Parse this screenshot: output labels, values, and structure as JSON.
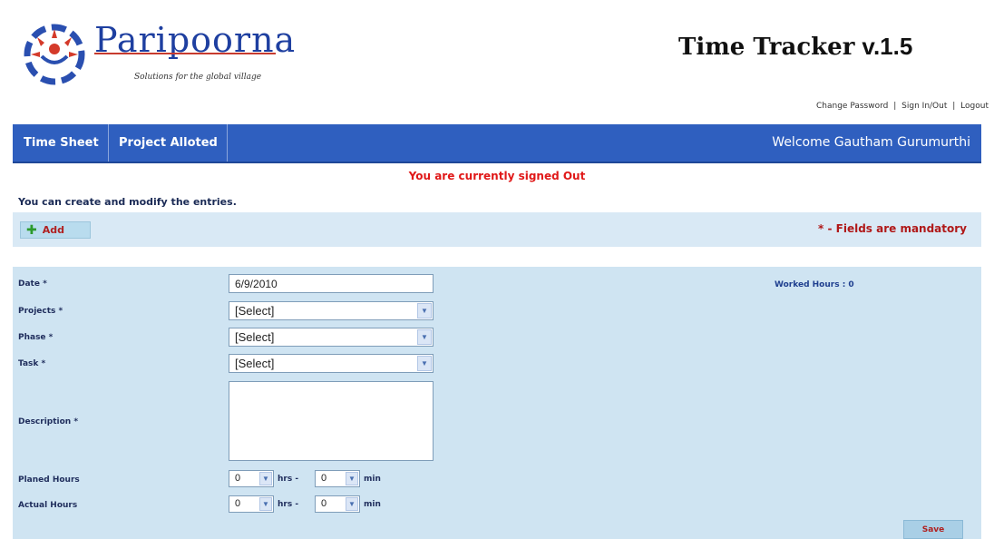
{
  "brand": {
    "name": "Paripoorna",
    "tagline": "Solutions for the global village"
  },
  "app": {
    "title": "Time Tracker",
    "version": "v.1.5"
  },
  "user_links": {
    "change_password": "Change Password",
    "sign_in_out": "Sign In/Out",
    "logout": "Logout",
    "separator": "|"
  },
  "nav": {
    "time_sheet": "Time Sheet",
    "project_alloted": "Project Alloted",
    "welcome": "Welcome Gautham Gurumurthi"
  },
  "status_message": "You are currently signed Out",
  "info_message": "You can create and modify the entries.",
  "toolbar": {
    "add_label": "Add",
    "mandatory_note": "* - Fields are mandatory"
  },
  "form": {
    "date_label": "Date *",
    "date_value": "6/9/2010",
    "projects_label": "Projects *",
    "projects_value": "[Select]",
    "phase_label": "Phase *",
    "phase_value": "[Select]",
    "task_label": "Task *",
    "task_value": "[Select]",
    "description_label": "Description *",
    "description_value": "",
    "planned_label": "Planed Hours",
    "planned_hrs": "0",
    "planned_min": "0",
    "actual_label": "Actual Hours",
    "actual_hrs": "0",
    "actual_min": "0",
    "hrs_unit": "hrs -",
    "min_unit": "min",
    "worked_hours": "Worked Hours : 0",
    "save_label": "Save"
  },
  "colors": {
    "nav_bg": "#2f5fbf",
    "status_red": "#e01818",
    "panel_bg": "#cfe4f2"
  }
}
